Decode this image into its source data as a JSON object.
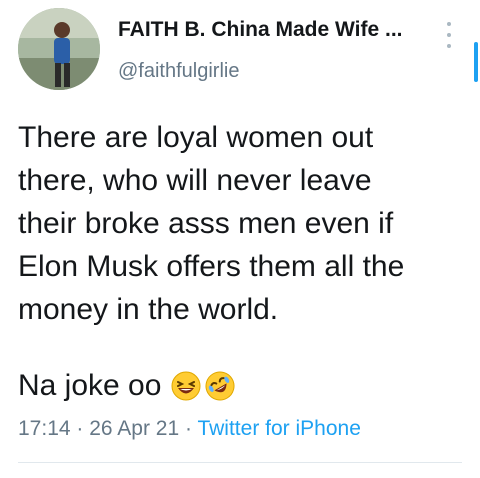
{
  "tweet": {
    "author_name": "FAITH B. China Made Wife ...",
    "author_handle": "@faithfulgirlie",
    "text": "There are loyal women out\nthere, who will never leave\ntheir broke asss men even if\nElon Musk offers them all the\nmoney in the world.",
    "second_line": "Na joke oo",
    "emojis": [
      "laughing-face-emoji",
      "rolling-on-floor-laughing-emoji"
    ],
    "time": "17:14",
    "date": "26 Apr 21",
    "separator": "·",
    "source": "Twitter for iPhone"
  },
  "icons": {
    "more": "more-vertical-icon"
  },
  "colors": {
    "link": "#1da1f2",
    "muted": "#657786",
    "text": "#14171a"
  }
}
